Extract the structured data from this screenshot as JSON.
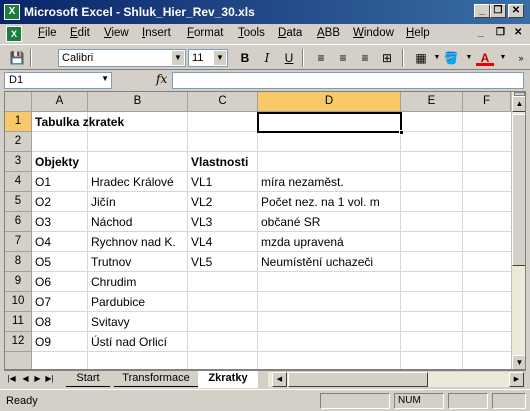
{
  "window": {
    "title": "Microsoft Excel - Shluk_Hier_Rev_30.xls",
    "minimize": "_",
    "restore": "❐",
    "close": "✕"
  },
  "menu": {
    "items": [
      "File",
      "Edit",
      "View",
      "Insert",
      "Format",
      "Tools",
      "Data",
      "ABB",
      "Window",
      "Help"
    ],
    "right_minimize": "_",
    "right_restore": "❐",
    "right_close": "✕"
  },
  "toolbar": {
    "font_name": "Calibri",
    "font_size": "11",
    "bold": "B",
    "italic": "I",
    "underline": "U"
  },
  "formula_bar": {
    "name_box": "D1",
    "fx": "fx",
    "value": ""
  },
  "sheet": {
    "columns": [
      "A",
      "B",
      "C",
      "D",
      "E",
      "F"
    ],
    "rows": [
      "1",
      "2",
      "3",
      "4",
      "5",
      "6",
      "7",
      "8",
      "9",
      "10",
      "11",
      "12"
    ],
    "cells": {
      "A1": "Tabulka zkratek",
      "A3": "Objekty",
      "C3": "Vlastnosti",
      "A4": "O1",
      "B4": "Hradec Králové",
      "C4": "VL1",
      "D4": "míra nezaměst.",
      "A5": "O2",
      "B5": "Jičín",
      "C5": "VL2",
      "D5": "Počet nez. na 1 vol. m",
      "A6": "O3",
      "B6": "Náchod",
      "C6": "VL3",
      "D6": "občané SR",
      "A7": "O4",
      "B7": "Rychnov nad K.",
      "C7": "VL4",
      "D7": "mzda upravená",
      "A8": "O5",
      "B8": "Trutnov",
      "C8": "VL5",
      "D8": "Neumístění uchazeči",
      "A9": "O6",
      "B9": "Chrudim",
      "A10": "O7",
      "B10": "Pardubice",
      "A11": "O8",
      "B11": "Svitavy",
      "A12": "O9",
      "B12": "Ústí nad Orlicí"
    },
    "active_cell": "D1"
  },
  "tabs": [
    "Start",
    "Transformace",
    "Zkratky"
  ],
  "active_tab": "Zkratky",
  "status": {
    "text": "Ready",
    "num": "NUM"
  }
}
